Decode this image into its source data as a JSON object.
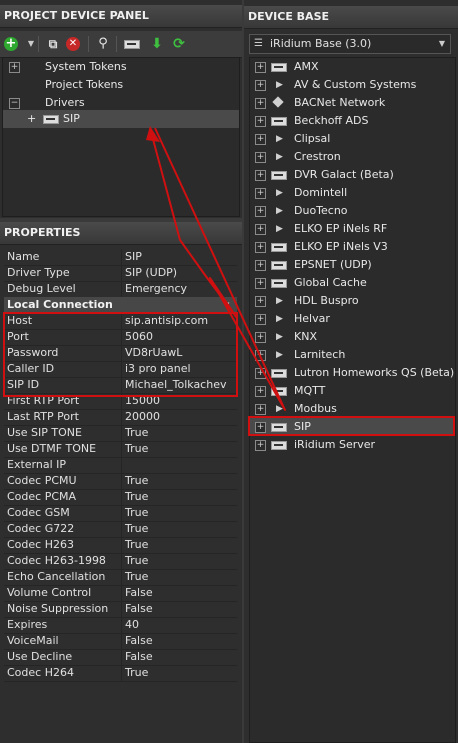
{
  "left": {
    "title": "PROJECT DEVICE PANEL",
    "tree": [
      {
        "label": "System Tokens",
        "expander": "+"
      },
      {
        "label": "Project Tokens",
        "expander": ""
      },
      {
        "label": "Drivers",
        "expander": "−"
      },
      {
        "label": "SIP",
        "expander": "+"
      }
    ]
  },
  "properties": {
    "title": "PROPERTIES",
    "top_rows": [
      {
        "name": "Name",
        "value": "SIP"
      },
      {
        "name": "Driver Type",
        "value": "SIP (UDP)"
      },
      {
        "name": "Debug Level",
        "value": "Emergency"
      }
    ],
    "section_label": "Local Connection",
    "rows": [
      {
        "name": "Host",
        "value": "sip.antisip.com"
      },
      {
        "name": "Port",
        "value": "5060"
      },
      {
        "name": "Password",
        "value": "VD8rUawL"
      },
      {
        "name": "Caller ID",
        "value": "i3 pro panel"
      },
      {
        "name": "SIP ID",
        "value": "Michael_Tolkachev"
      },
      {
        "name": "First RTP Port",
        "value": "15000"
      },
      {
        "name": "Last RTP Port",
        "value": "20000"
      },
      {
        "name": "Use SIP TONE",
        "value": "True"
      },
      {
        "name": "Use DTMF TONE",
        "value": "True"
      },
      {
        "name": "External IP",
        "value": ""
      },
      {
        "name": "Codec PCMU",
        "value": "True"
      },
      {
        "name": "Codec PCMA",
        "value": "True"
      },
      {
        "name": "Codec GSM",
        "value": "True"
      },
      {
        "name": "Codec G722",
        "value": "True"
      },
      {
        "name": "Codec H263",
        "value": "True"
      },
      {
        "name": "Codec H263-1998",
        "value": "True"
      },
      {
        "name": "Echo Cancellation",
        "value": "True"
      },
      {
        "name": "Volume Control",
        "value": "False"
      },
      {
        "name": "Noise Suppression",
        "value": "False"
      },
      {
        "name": "Expires",
        "value": "40"
      },
      {
        "name": "VoiceMail",
        "value": "False"
      },
      {
        "name": "Use Decline",
        "value": "False"
      },
      {
        "name": "Codec H264",
        "value": "True"
      }
    ]
  },
  "right": {
    "title": "DEVICE BASE",
    "base_selected": "iRidium Base (3.0)",
    "items": [
      {
        "label": "AMX",
        "icon": "driver-icon"
      },
      {
        "label": "AV & Custom Systems",
        "icon": "chevron-icon"
      },
      {
        "label": "BACNet Network",
        "icon": "diamond-icon"
      },
      {
        "label": "Beckhoff ADS",
        "icon": "driver-icon"
      },
      {
        "label": "Clipsal",
        "icon": "chevron-icon"
      },
      {
        "label": "Crestron",
        "icon": "chevron-icon"
      },
      {
        "label": "DVR Galact (Beta)",
        "icon": "driver-icon"
      },
      {
        "label": "Domintell",
        "icon": "chevron-icon"
      },
      {
        "label": "DuoTecno",
        "icon": "chevron-icon"
      },
      {
        "label": "ELKO EP iNels RF",
        "icon": "chevron-icon"
      },
      {
        "label": "ELKO EP iNels V3",
        "icon": "driver-icon"
      },
      {
        "label": "EPSNET (UDP)",
        "icon": "driver-icon"
      },
      {
        "label": "Global Cache",
        "icon": "driver-icon"
      },
      {
        "label": "HDL Buspro",
        "icon": "chevron-icon"
      },
      {
        "label": "Helvar",
        "icon": "chevron-icon"
      },
      {
        "label": "KNX",
        "icon": "chevron-icon"
      },
      {
        "label": "Larnitech",
        "icon": "chevron-icon"
      },
      {
        "label": "Lutron Homeworks QS (Beta)",
        "icon": "driver-icon"
      },
      {
        "label": "MQTT",
        "icon": "driver-icon"
      },
      {
        "label": "Modbus",
        "icon": "chevron-icon"
      },
      {
        "label": "SIP",
        "icon": "driver-icon"
      },
      {
        "label": "iRidium Server",
        "icon": "driver-icon"
      }
    ]
  },
  "colors": {
    "highlight": "#d01010",
    "selected_row": "#4a4a4a",
    "add_icon": "#2ea82e",
    "delete_icon": "#c62828"
  }
}
